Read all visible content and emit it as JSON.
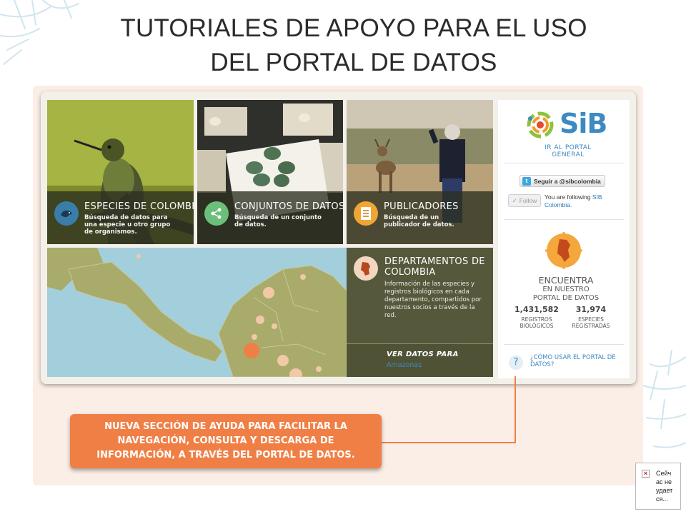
{
  "slide": {
    "title_line1": "TUTORIALES DE APOYO PARA EL USO",
    "title_line2": "DEL PORTAL DE DATOS"
  },
  "tiles": {
    "especies": {
      "heading": "ESPECIES DE COLOMBIA",
      "desc": "Búsqueda de datos para una especie u otro grupo de organismos.",
      "icon": "bird-icon"
    },
    "conjuntos": {
      "heading": "CONJUNTOS DE DATOS",
      "desc": "Búsqueda de un conjunto de datos.",
      "icon": "share-nodes-icon"
    },
    "publicadores": {
      "heading": "PUBLICADORES",
      "desc": "Búsqueda de un publicador de datos.",
      "icon": "document-icon"
    },
    "departamentos": {
      "heading_line1": "DEPARTAMENTOS DE",
      "heading_line2": "COLOMBIA",
      "desc": "Información de las especies y registros biológicos en cada departamento, compartidos por nuestros socios a través de la red.",
      "ver_datos": "VER DATOS PARA",
      "selected_department": "Amazonas",
      "icon": "colombia-map-icon"
    }
  },
  "sidebar": {
    "logo_text": "SiB",
    "portal_link": "IR AL PORTAL GENERAL",
    "twitter_button": "Seguir a @sibcolombia",
    "follow_button": "Follow",
    "follow_status": "You are following",
    "follow_link": "SIB Colombia.",
    "encuentra": "ENCUENTRA",
    "en_nuestro": "EN NUESTRO",
    "portal_de_datos": "PORTAL DE DATOS",
    "registros_count": "1,431,582",
    "registros_label_1": "REGISTROS",
    "registros_label_2": "BIOLÓGICOS",
    "especies_count": "31,974",
    "especies_label_1": "ESPECIES",
    "especies_label_2": "REGISTRADAS",
    "help_icon_glyph": "?",
    "help_link_1": "¿CÓMO USAR EL PORTAL DE",
    "help_link_2": "DATOS?"
  },
  "callout": {
    "line1": "NUEVA SECCIÓN DE AYUDA PARA FACILITAR LA",
    "line2": "NAVEGACIÓN, CONSULTA Y DESCARGA DE",
    "line3": "INFORMACIÓN, A TRAVÉS DEL PORTAL DE DATOS."
  },
  "broken_image": {
    "line1": "Сейч",
    "line2": "ас не",
    "line3": "удает",
    "line4": "ся..."
  },
  "colors": {
    "accent_orange": "#f07f46",
    "sib_blue": "#3d8ac2",
    "tile_overlay": "#2c3020",
    "map_water": "#9fcad8",
    "map_land": "#a9ab6b"
  }
}
